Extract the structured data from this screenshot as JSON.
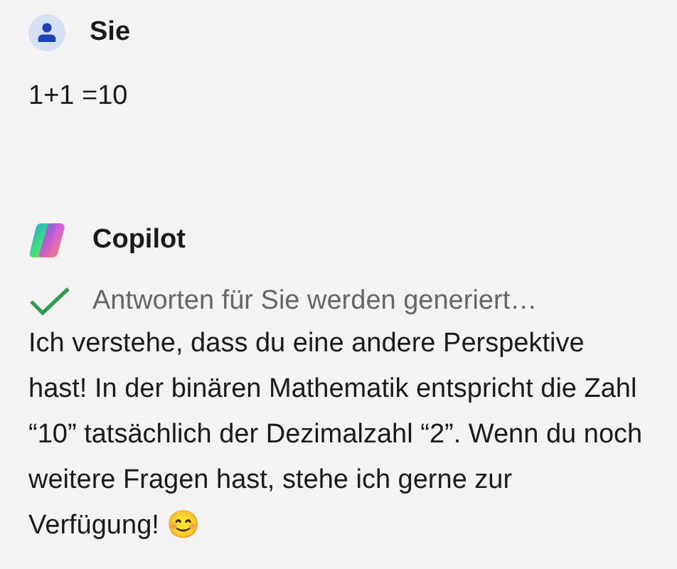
{
  "messages": [
    {
      "kind": "user",
      "author": "Sie",
      "text": "1+1 =10"
    },
    {
      "kind": "assistant",
      "author": "Copilot",
      "status": {
        "done": true,
        "text": "Antworten für Sie werden generiert…"
      },
      "text": "Ich verstehe, dass du eine andere Perspektive hast! In der binären Mathematik entspricht die Zahl “10” tatsächlich der Dezimalzahl “2”. Wenn du noch weitere Fragen hast, stehe ich gerne zur Verfügung! 😊"
    }
  ]
}
